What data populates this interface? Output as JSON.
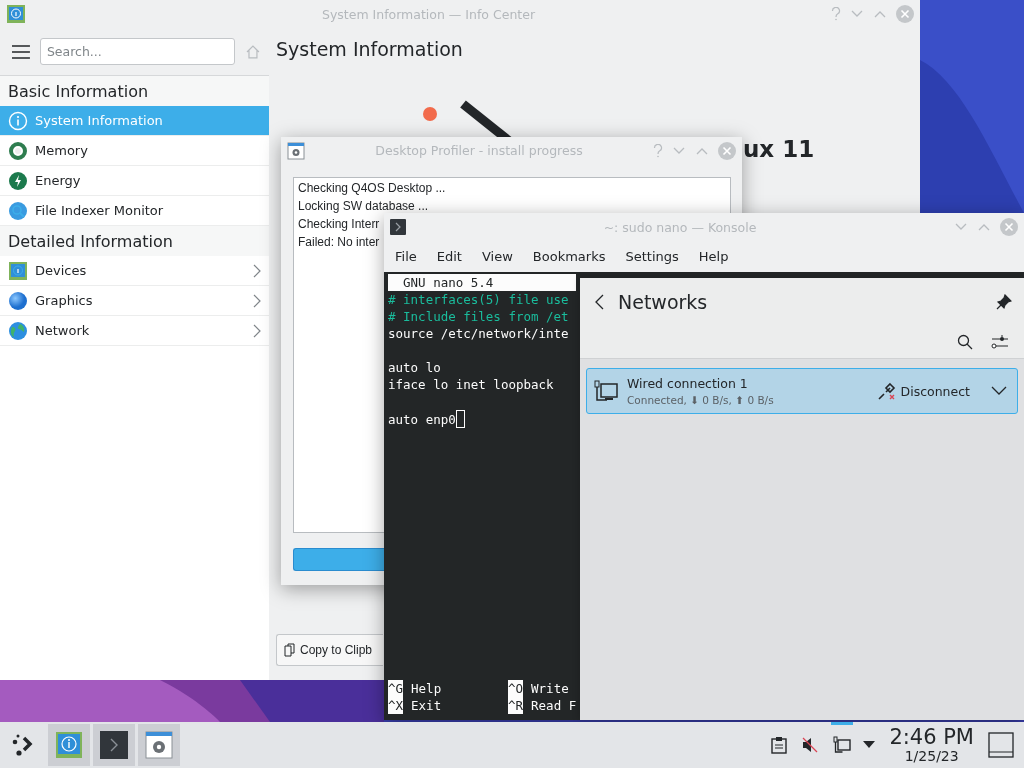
{
  "info_center": {
    "title": "System Information — Info Center",
    "search": {
      "placeholder": "Search..."
    },
    "page_title": "System Information",
    "logo_text": "ux 11",
    "copy_button": "Copy to Clipb",
    "sections": [
      {
        "heading": "Basic Information",
        "items": [
          {
            "label": "System Information",
            "kind": "info",
            "selected": true
          },
          {
            "label": "Memory",
            "kind": "memory",
            "selected": false
          },
          {
            "label": "Energy",
            "kind": "energy",
            "selected": false
          },
          {
            "label": "File Indexer Monitor",
            "kind": "indexer",
            "selected": false
          }
        ]
      },
      {
        "heading": "Detailed Information",
        "items": [
          {
            "label": "Devices",
            "kind": "devices",
            "selected": false
          },
          {
            "label": "Graphics",
            "kind": "graphics",
            "selected": false
          },
          {
            "label": "Network",
            "kind": "network",
            "selected": false
          }
        ]
      }
    ]
  },
  "profiler": {
    "title": "Desktop Profiler - install progress",
    "log": [
      "Checking Q4OS Desktop ...",
      "Locking SW database ...",
      "Checking Interr",
      "Failed: No inter"
    ],
    "progress_bar": true
  },
  "konsole": {
    "title": "~: sudo nano — Konsole",
    "menu": [
      "File",
      "Edit",
      "View",
      "Bookmarks",
      "Settings",
      "Help"
    ],
    "nano_header": "GNU nano 5.4",
    "lines": [
      {
        "text": "# interfaces(5) file use",
        "kind": "comment"
      },
      {
        "text": "# Include files from /et",
        "kind": "comment"
      },
      {
        "text": "source /etc/network/inte",
        "kind": "code"
      },
      {
        "kind": "blank"
      },
      {
        "text": "auto lo",
        "kind": "code"
      },
      {
        "text": "iface lo inet loopback",
        "kind": "code"
      },
      {
        "kind": "blank"
      },
      {
        "text": "auto enp0",
        "kind": "cursor"
      }
    ],
    "shortcuts": [
      [
        {
          "key": "^G",
          "label": "Help"
        },
        {
          "key": "^O",
          "label": "Write"
        }
      ],
      [
        {
          "key": "^X",
          "label": "Exit"
        },
        {
          "key": "^R",
          "label": "Read F"
        }
      ]
    ]
  },
  "networks": {
    "title": "Networks",
    "connections": [
      {
        "name": "Wired connection 1",
        "status": "Connected, ⬇ 0 B/s, ⬆ 0 B/s",
        "action": "Disconnect",
        "selected": true
      }
    ]
  },
  "taskbar": {
    "tasks": [
      {
        "kind": "info"
      },
      {
        "kind": "terminal"
      },
      {
        "kind": "settings"
      }
    ],
    "tray": [
      {
        "kind": "clipboard",
        "selected": false
      },
      {
        "kind": "volume-muted",
        "selected": false
      },
      {
        "kind": "network",
        "selected": true
      }
    ],
    "time": "2:46 PM",
    "date": "1/25/23"
  }
}
